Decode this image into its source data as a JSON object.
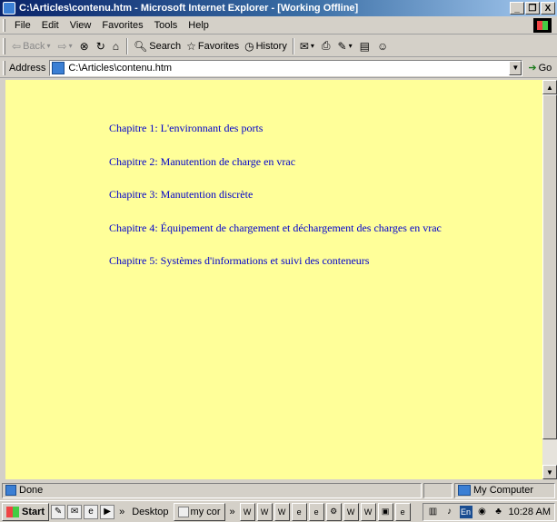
{
  "window": {
    "title": "C:\\Articles\\contenu.htm - Microsoft Internet Explorer - [Working Offline]",
    "buttons": [
      "_",
      "Ő",
      "X"
    ]
  },
  "menu": [
    "File",
    "Edit",
    "View",
    "Favorites",
    "Tools",
    "Help"
  ],
  "toolbar": {
    "back": "Back",
    "search": "Search",
    "favorites": "Favorites",
    "history": "History"
  },
  "address": {
    "label": "Address",
    "url": "C:\\Articles\\contenu.htm",
    "go": "Go"
  },
  "chapters": [
    "Chapitre 1: L'environnant des ports",
    "Chapitre 2: Manutention de charge en vrac",
    "Chapitre 3: Manutention discrète",
    "Chapitre 4: Équipement de chargement et déchargement des charges en vrac",
    "Chapitre 5: Systèmes d'informations et suivi des conteneurs"
  ],
  "colors": {
    "page_background": "#ffff99",
    "link": "#0000cc"
  },
  "status": {
    "text": "Done",
    "zone": "My Computer"
  },
  "taskbar": {
    "start": "Start",
    "chevron": "»",
    "desktop": "Desktop",
    "my_computer": "my cor",
    "chevron2": "»",
    "clock": "10:28 AM",
    "lang": "En"
  }
}
